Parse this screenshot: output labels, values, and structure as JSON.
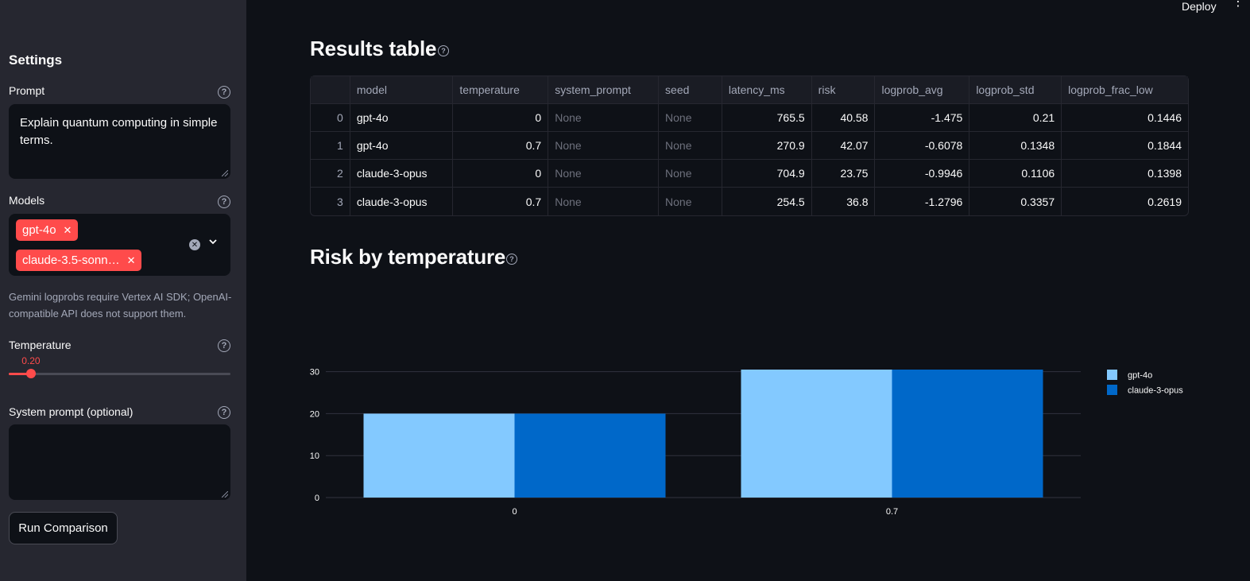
{
  "header": {
    "deploy_label": "Deploy",
    "menu_icon": "kebab-menu-icon"
  },
  "sidebar": {
    "title": "Settings",
    "prompt": {
      "label": "Prompt",
      "value": "Explain quantum computing in simple terms."
    },
    "models": {
      "label": "Models",
      "selected": [
        "gpt-4o",
        "claude-3.5-sonn…"
      ]
    },
    "note": "Gemini logprobs require Vertex AI SDK; OpenAI-compatible API does not support them.",
    "temperature": {
      "label": "Temperature",
      "value_label": "0.20",
      "value": 0.2,
      "min": 0,
      "max": 2
    },
    "system_prompt": {
      "label": "System prompt (optional)",
      "value": ""
    },
    "run_label": "Run Comparison"
  },
  "results": {
    "title": "Results table",
    "columns": [
      "",
      "model",
      "temperature",
      "system_prompt",
      "seed",
      "latency_ms",
      "risk",
      "logprob_avg",
      "logprob_std",
      "logprob_frac_low"
    ],
    "rows": [
      [
        "0",
        "gpt-4o",
        "0",
        "None",
        "None",
        "765.5",
        "40.58",
        "-1.475",
        "0.21",
        "0.1446"
      ],
      [
        "1",
        "gpt-4o",
        "0.7",
        "None",
        "None",
        "270.9",
        "42.07",
        "-0.6078",
        "0.1348",
        "0.1844"
      ],
      [
        "2",
        "claude-3-opus",
        "0",
        "None",
        "None",
        "704.9",
        "23.75",
        "-0.9946",
        "0.1106",
        "0.1398"
      ],
      [
        "3",
        "claude-3-opus",
        "0.7",
        "None",
        "None",
        "254.5",
        "36.8",
        "-1.2796",
        "0.3357",
        "0.2619"
      ]
    ]
  },
  "chart_section": {
    "title": "Risk by temperature"
  },
  "chart_data": {
    "type": "bar",
    "title": "",
    "xlabel": "",
    "ylabel": "",
    "categories": [
      "0",
      "0.7"
    ],
    "series": [
      {
        "name": "gpt-4o",
        "color": "#83c9ff",
        "values": [
          20,
          30.5
        ]
      },
      {
        "name": "claude-3-opus",
        "color": "#0068c9",
        "values": [
          20,
          30.5
        ]
      }
    ],
    "ylim": [
      0,
      30.5
    ],
    "yticks": [
      0,
      10,
      20,
      30
    ],
    "grid": true,
    "legend": "right"
  }
}
